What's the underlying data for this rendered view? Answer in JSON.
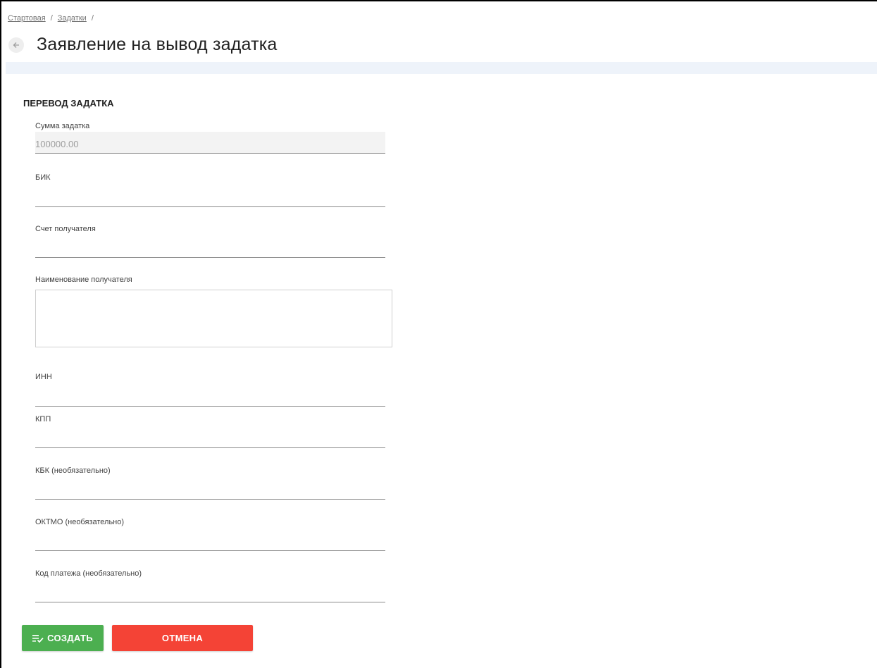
{
  "breadcrumb": {
    "items": [
      "Стартовая",
      "Задатки"
    ],
    "separator": "/"
  },
  "header": {
    "back_icon": "arrow-left-icon",
    "title": "Заявление на вывод задатка"
  },
  "form": {
    "section_title": "ПЕРЕВОД ЗАДАТКА",
    "fields": {
      "amount": {
        "label": "Сумма задатка",
        "value": "100000.00"
      },
      "bik": {
        "label": "БИК",
        "value": ""
      },
      "account": {
        "label": "Счет получателя",
        "value": ""
      },
      "recipient_name": {
        "label": "Наименование получателя",
        "value": ""
      },
      "inn": {
        "label": "ИНН",
        "value": ""
      },
      "kpp": {
        "label": "КПП",
        "value": ""
      },
      "kbk": {
        "label": "КБК (необязательно)",
        "value": ""
      },
      "oktmo": {
        "label": "ОКТМО (необязательно)",
        "value": ""
      },
      "payment_code": {
        "label": "Код платежа (необязательно)",
        "value": ""
      }
    }
  },
  "actions": {
    "create_label": "СОЗДАТЬ",
    "create_icon": "playlist-check-icon",
    "cancel_label": "ОТМЕНА"
  },
  "colors": {
    "create": "#4caf50",
    "cancel": "#f44336",
    "band": "#eef3fa"
  }
}
